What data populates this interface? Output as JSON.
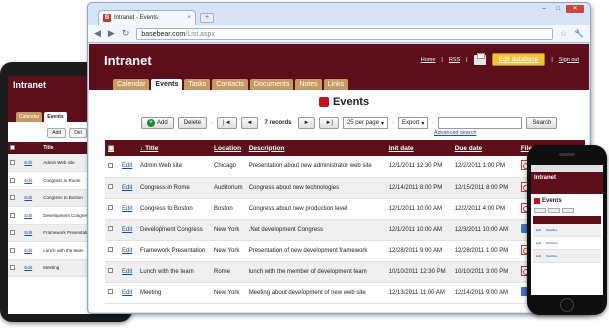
{
  "tablet": {
    "brand": "Intranet",
    "tabs": [
      "Calendar",
      "Events"
    ],
    "buttons": [
      "Add",
      "Del"
    ],
    "col_title": "Title",
    "rows": [
      {
        "edit": "Edit",
        "title": "Admin Web site"
      },
      {
        "edit": "Edit",
        "title": "Congress in Rome"
      },
      {
        "edit": "Edit",
        "title": "Congress to Boston"
      },
      {
        "edit": "Edit",
        "title": "Development Congress"
      },
      {
        "edit": "Edit",
        "title": "Framework Presentation"
      },
      {
        "edit": "Edit",
        "title": "Lunch with the team"
      },
      {
        "edit": "Edit",
        "title": "Meeting"
      }
    ]
  },
  "browser": {
    "tab_title": "Intranet - Events",
    "url_host": "basebear.com",
    "url_path": "/List.aspx"
  },
  "app": {
    "brand": "Intranet",
    "links": {
      "home": "Home",
      "rss": "RSS",
      "edit_db": "Edit database",
      "sign_out": "Sign out"
    },
    "tabs": [
      "Calendar",
      "Events",
      "Tasks",
      "Contacts",
      "Documents",
      "Notes",
      "Links"
    ],
    "active_tab": "Events",
    "page_title": "Events",
    "toolbar": {
      "add": "Add",
      "delete": "Delete",
      "first": "|◄",
      "prev": "◄",
      "records": "7 records",
      "next": "►",
      "last": "►|",
      "per_page": "25 per page",
      "export": "Export",
      "search": "Search",
      "advanced_search": "Advanced search"
    },
    "columns": {
      "title": "Title",
      "location": "Location",
      "description": "Description",
      "init_date": "Init date",
      "due_date": "Due date",
      "file": "File"
    },
    "rows": [
      {
        "edit": "Edit",
        "title": "Admin Web site",
        "location": "Chicago",
        "description": "Presentation about new administrator web site",
        "init": "12/1/2011 12:30 PM",
        "due": "12/2/2011 1:00 PM"
      },
      {
        "edit": "Edit",
        "title": "Congress in Rome",
        "location": "Auditorium",
        "description": "Congress about new technologies",
        "init": "12/14/2011 8:00 PM",
        "due": "12/15/2011 8:00 PM"
      },
      {
        "edit": "Edit",
        "title": "Congress to Boston",
        "location": "Boston",
        "description": "Congress about new production level",
        "init": "12/1/2011 10:00 AM",
        "due": "12/2/2011 4:00 PM"
      },
      {
        "edit": "Edit",
        "title": "Development Congress",
        "location": "New York",
        "description": ".Net development Congress",
        "init": "12/1/2011 10:00 AM",
        "due": "12/3/2011 10:00 AM"
      },
      {
        "edit": "Edit",
        "title": "Framework Presentation",
        "location": "New York",
        "description": "Presentation of new development framework",
        "init": "12/28/2011 9:00 AM",
        "due": "12/28/2011 1:00 PM"
      },
      {
        "edit": "Edit",
        "title": "Lunch with the team",
        "location": "Rome",
        "description": "lunch with the member of development team",
        "init": "10/10/2011 12:30 PM",
        "due": "10/10/2011 3:00 PM"
      },
      {
        "edit": "Edit",
        "title": "Meeting",
        "location": "New York",
        "description": "Meeting about development of new web site",
        "init": "12/13/2011 11:00 AM",
        "due": "12/14/2011 9:00 AM"
      }
    ]
  },
  "phone": {
    "brand": "Intranet",
    "page_title": "Events",
    "rows": [
      {
        "edit": "Edit",
        "mod": "Modifica"
      },
      {
        "edit": "Edit",
        "mod": "Modifica"
      },
      {
        "edit": "Edit",
        "mod": "Modifica"
      }
    ]
  }
}
